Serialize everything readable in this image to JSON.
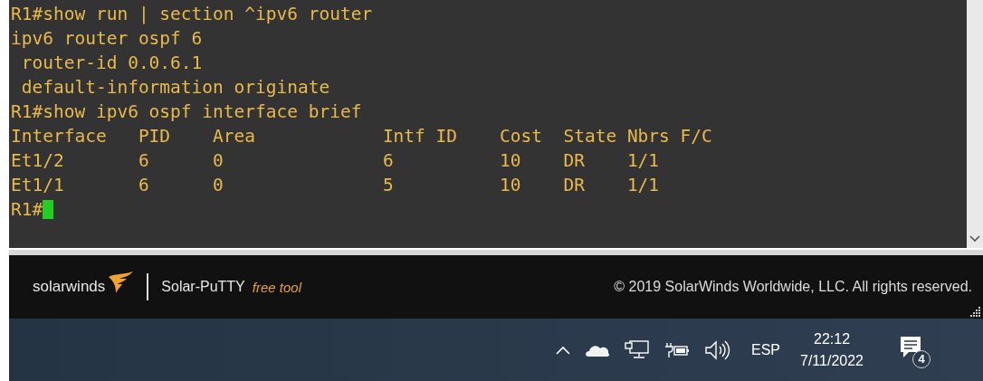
{
  "terminal": {
    "lines": [
      "R1#show run | section ^ipv6 router",
      "ipv6 router ospf 6",
      " router-id 0.0.6.1",
      " default-information originate",
      "R1#show ipv6 ospf interface brief"
    ],
    "table": {
      "columns": [
        "Interface",
        "PID",
        "Area",
        "Intf ID",
        "Cost",
        "State",
        "Nbrs F/C"
      ],
      "rows": [
        [
          "Et1/2",
          "6",
          "0",
          "6",
          "10",
          "DR",
          "1/1"
        ],
        [
          "Et1/1",
          "6",
          "0",
          "5",
          "10",
          "DR",
          "1/1"
        ]
      ]
    },
    "prompt": "R1#"
  },
  "footer": {
    "brand": "solarwinds",
    "product": "Solar-PuTTY",
    "tag": "free tool",
    "copyright": "© 2019 SolarWinds Worldwide, LLC. All rights reserved."
  },
  "taskbar": {
    "language": "ESP",
    "time": "22:12",
    "date": "7/11/2022",
    "notification_count": "4"
  }
}
